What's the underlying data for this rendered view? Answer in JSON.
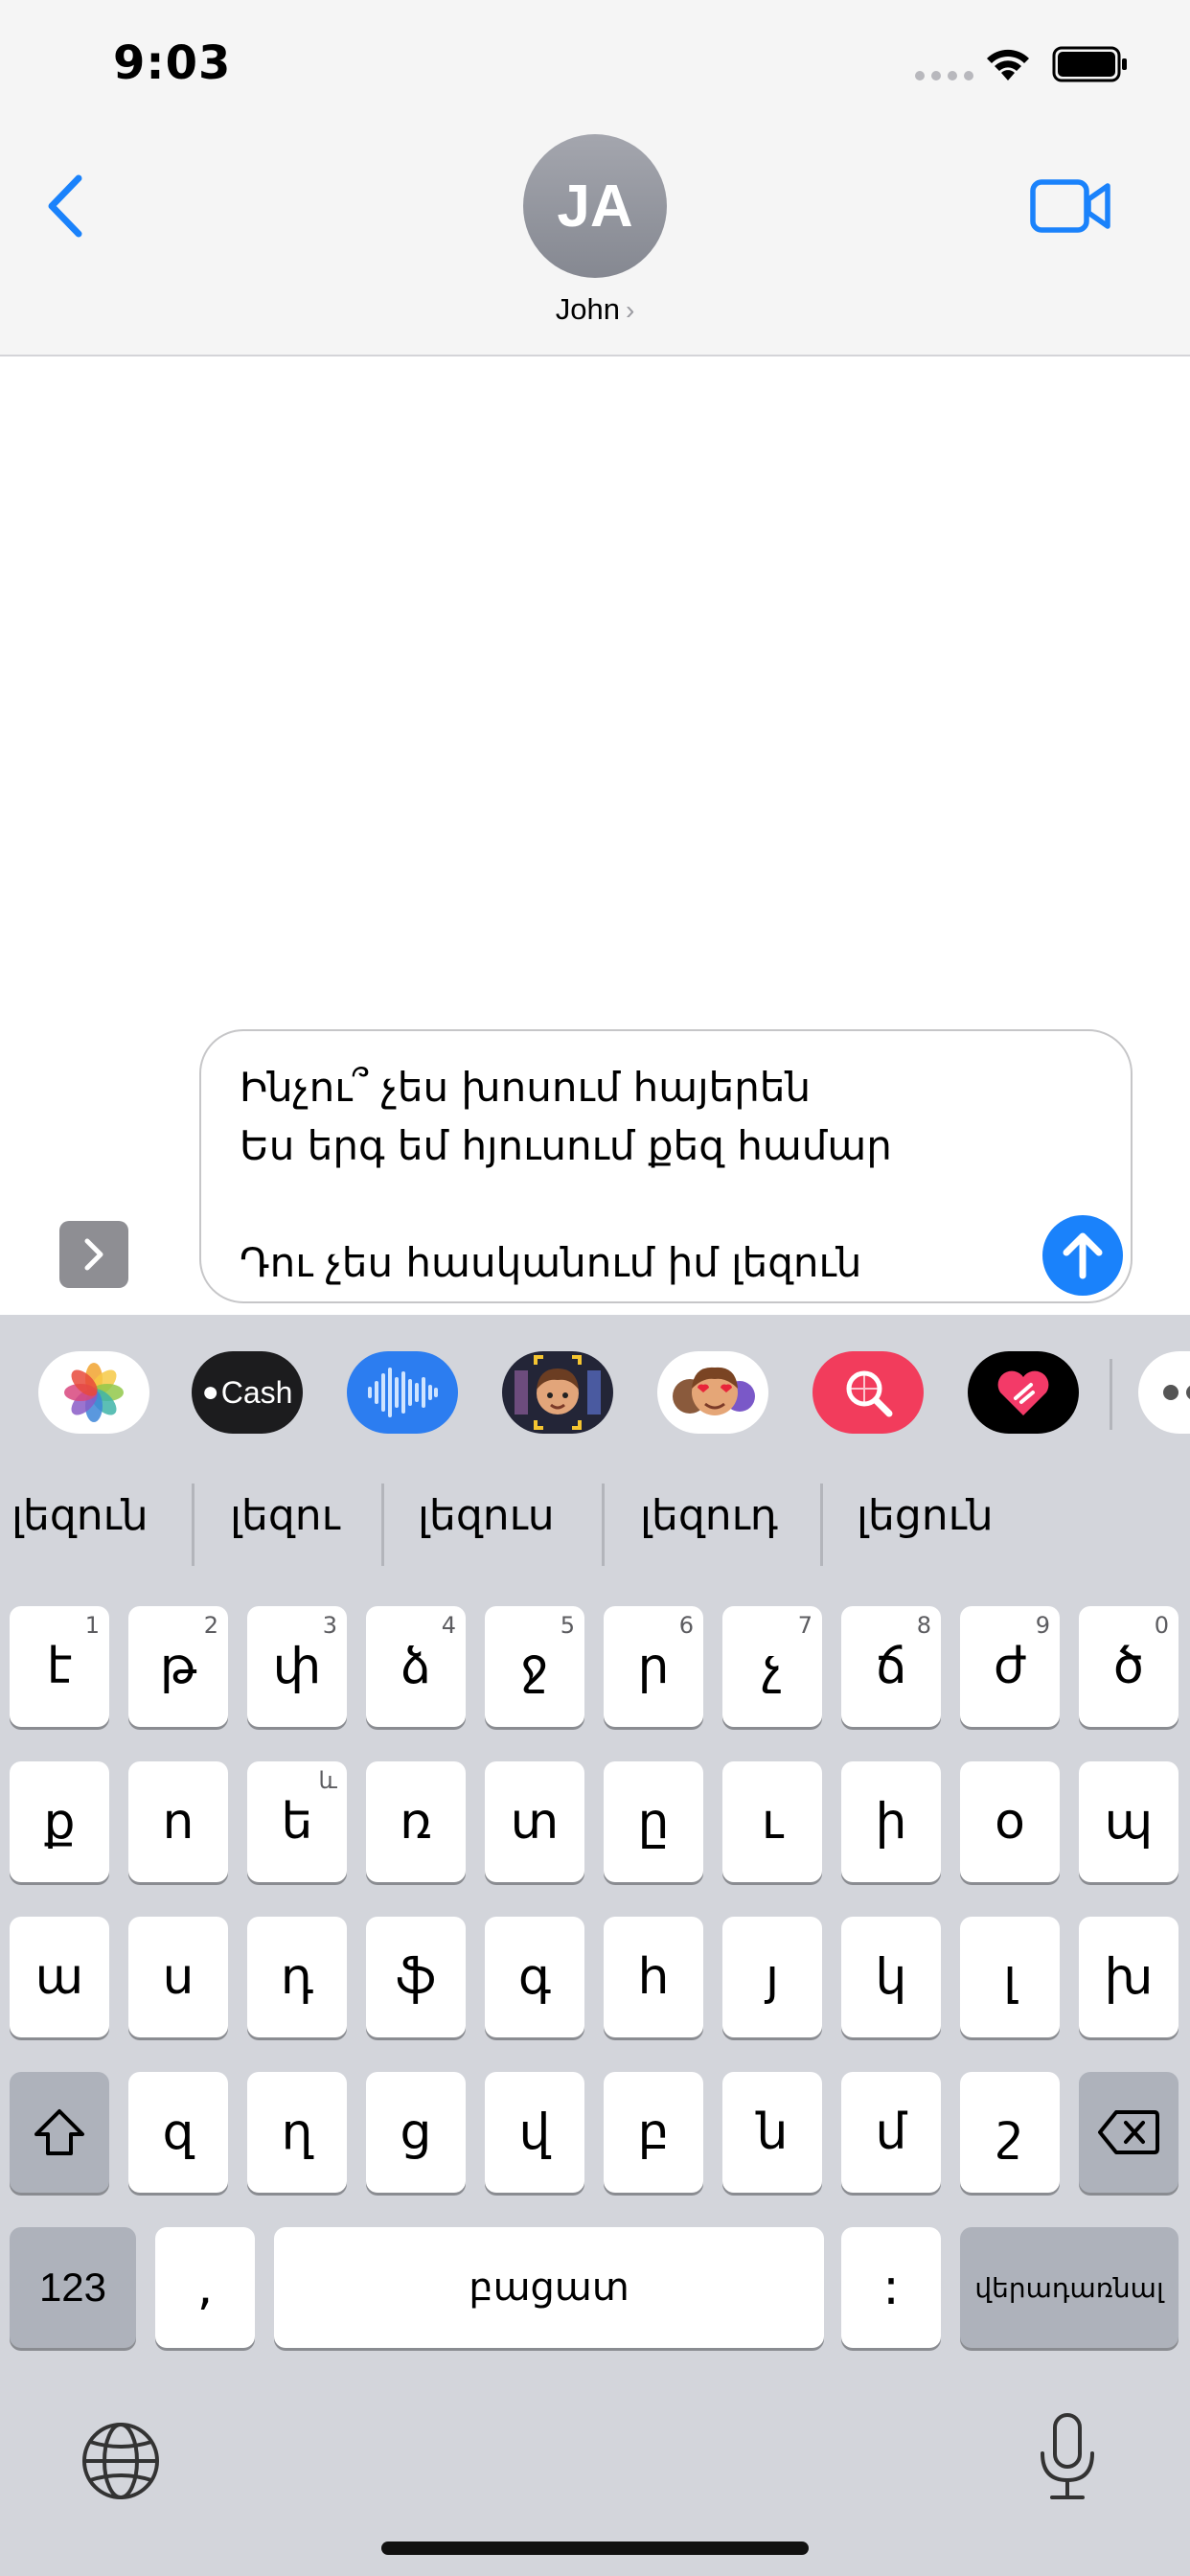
{
  "status_bar": {
    "time": "9:03"
  },
  "header": {
    "avatar_initials": "JA",
    "contact_name": "John",
    "contact_chevron": "›"
  },
  "compose": {
    "message_lines": "Ինչու՞ չես խոսում հայերեն\nԵս երգ եմ հյուսում քեզ համար\n\nԴու չես հասկանում իմ լեզուն"
  },
  "app_strip": {
    "items": [
      "photos-app",
      "apple-cash-app",
      "audio-app",
      "memoji-app",
      "animoji-stickers-app",
      "image-search-app",
      "digital-touch-app",
      "more-apps"
    ],
    "cash_label": "Cash"
  },
  "suggestions": [
    "լեզուն",
    "լեզու",
    "լեզուս",
    "լեզուդ",
    "լեցուն"
  ],
  "keyboard": {
    "row1": [
      {
        "k": "է",
        "n": "1"
      },
      {
        "k": "թ",
        "n": "2"
      },
      {
        "k": "փ",
        "n": "3"
      },
      {
        "k": "ձ",
        "n": "4"
      },
      {
        "k": "ջ",
        "n": "5"
      },
      {
        "k": "ր",
        "n": "6"
      },
      {
        "k": "չ",
        "n": "7"
      },
      {
        "k": "ճ",
        "n": "8"
      },
      {
        "k": "ժ",
        "n": "9"
      },
      {
        "k": "ծ",
        "n": "0"
      }
    ],
    "row2": [
      {
        "k": "ք",
        "n": ""
      },
      {
        "k": "ո",
        "n": ""
      },
      {
        "k": "ե",
        "n": "և"
      },
      {
        "k": "ռ",
        "n": ""
      },
      {
        "k": "տ",
        "n": ""
      },
      {
        "k": "ը",
        "n": ""
      },
      {
        "k": "ւ",
        "n": ""
      },
      {
        "k": "ի",
        "n": ""
      },
      {
        "k": "օ",
        "n": ""
      },
      {
        "k": "պ",
        "n": ""
      }
    ],
    "row3": [
      "ա",
      "ս",
      "դ",
      "ֆ",
      "գ",
      "հ",
      "յ",
      "կ",
      "լ",
      "խ"
    ],
    "row4": [
      "զ",
      "ղ",
      "ց",
      "վ",
      "բ",
      "ն",
      "մ",
      "շ"
    ],
    "numbers_key": "123",
    "comma_key": ",",
    "space_key": "բացատ",
    "colon_key": ":",
    "return_key": "վերադառնալ"
  },
  "colors": {
    "accent": "#1a82fb",
    "keyboard_bg": "#d3d5db"
  }
}
